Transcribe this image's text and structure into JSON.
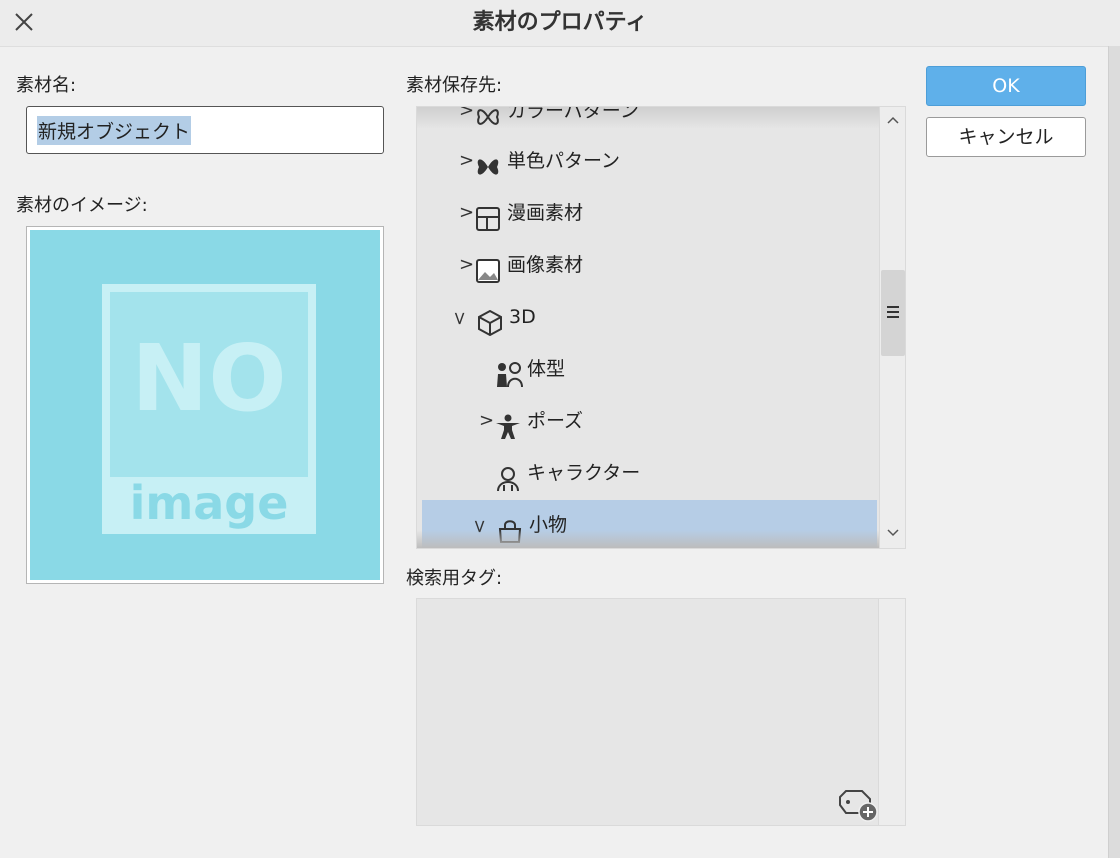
{
  "window": {
    "title": "素材のプロパティ"
  },
  "fields": {
    "name_label": "素材名:",
    "name_value": "新規オブジェクト",
    "image_label": "素材のイメージ:",
    "image_placeholder": {
      "big": "NO",
      "small": "image"
    },
    "location_label": "素材保存先:",
    "tags_label": "検索用タグ:"
  },
  "tree": {
    "items": [
      {
        "label": "カラーパターン",
        "icon": "butterfly-outline-icon",
        "expanded": false
      },
      {
        "label": "単色パターン",
        "icon": "butterfly-icon",
        "expanded": false
      },
      {
        "label": "漫画素材",
        "icon": "manga-frame-icon",
        "expanded": false
      },
      {
        "label": "画像素材",
        "icon": "image-icon",
        "expanded": false
      },
      {
        "label": "3D",
        "icon": "cube-icon",
        "expanded": true
      },
      {
        "label": "体型",
        "icon": "body-type-icon"
      },
      {
        "label": "ポーズ",
        "icon": "pose-icon",
        "expanded": false
      },
      {
        "label": "キャラクター",
        "icon": "character-icon"
      },
      {
        "label": "小物",
        "icon": "bag-icon",
        "expanded": true,
        "selected": true
      }
    ]
  },
  "buttons": {
    "ok": "OK",
    "cancel": "キャンセル"
  },
  "colors": {
    "accent": "#5fb0ea",
    "selection": "#b6cde6",
    "preview_bg": "#8ad9e6"
  }
}
